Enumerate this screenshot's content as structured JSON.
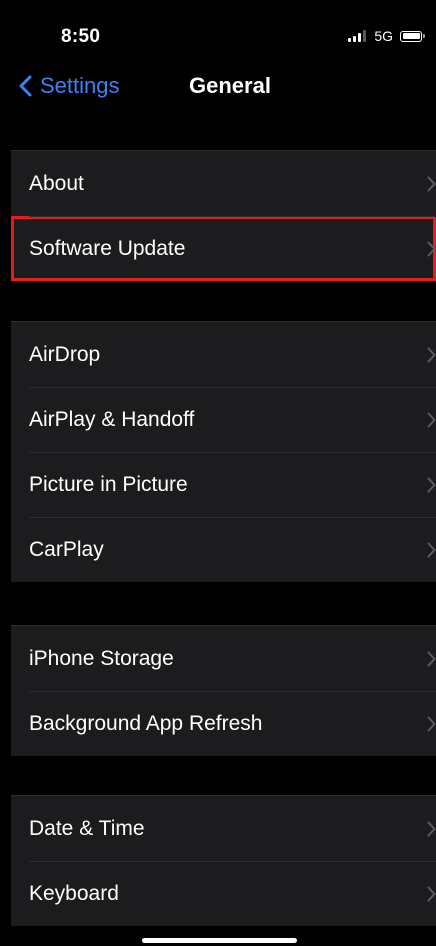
{
  "status_bar": {
    "time": "8:50",
    "network": "5G",
    "signal_bars_active": 3,
    "signal_bars_total": 4,
    "battery_level": 1.0
  },
  "nav": {
    "back_label": "Settings",
    "title": "General"
  },
  "colors": {
    "background": "#000000",
    "cell": "#1c1c1e",
    "accent": "#3b82f6",
    "highlight": "#e11d1d",
    "chevron": "#5c5c60"
  },
  "groups": [
    {
      "items": [
        {
          "label": "About"
        },
        {
          "label": "Software Update",
          "highlighted": true
        }
      ]
    },
    {
      "items": [
        {
          "label": "AirDrop"
        },
        {
          "label": "AirPlay & Handoff"
        },
        {
          "label": "Picture in Picture"
        },
        {
          "label": "CarPlay"
        }
      ]
    },
    {
      "items": [
        {
          "label": "iPhone Storage"
        },
        {
          "label": "Background App Refresh"
        }
      ]
    },
    {
      "items": [
        {
          "label": "Date & Time"
        },
        {
          "label": "Keyboard"
        }
      ]
    }
  ]
}
